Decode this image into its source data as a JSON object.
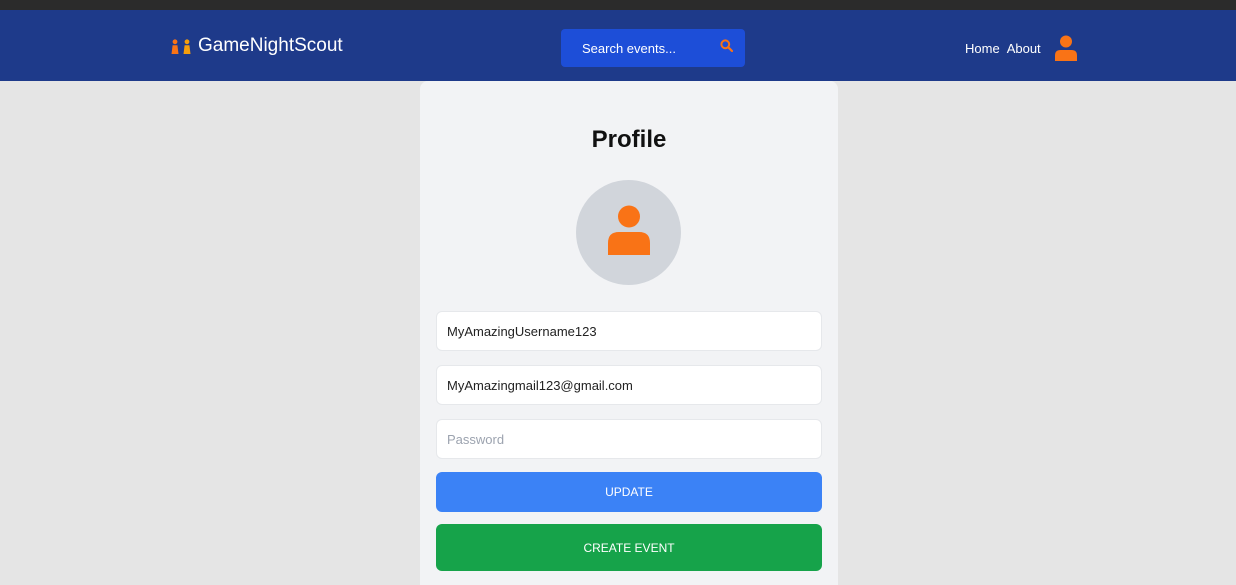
{
  "brand": {
    "name": "GameNightScout",
    "logo_icon": "two-figures-icon"
  },
  "search": {
    "placeholder": "Search events...",
    "icon": "search-icon"
  },
  "nav": {
    "links": [
      {
        "label": "Home"
      },
      {
        "label": "About"
      }
    ],
    "profile_icon": "user-icon"
  },
  "profile": {
    "title": "Profile",
    "avatar_icon": "user-icon",
    "username_value": "MyAmazingUsername123",
    "email_value": "MyAmazingmail123@gmail.com",
    "password_placeholder": "Password",
    "update_label": "UPDATE",
    "create_event_label": "CREATE EVENT"
  },
  "colors": {
    "navbar": "#1e3a8a",
    "search_bg": "#1d4ed8",
    "accent_orange": "#f97316",
    "update_button": "#3b82f6",
    "create_button": "#16a34a",
    "page_bg": "#e5e5e5",
    "card_bg": "#f2f3f5"
  }
}
